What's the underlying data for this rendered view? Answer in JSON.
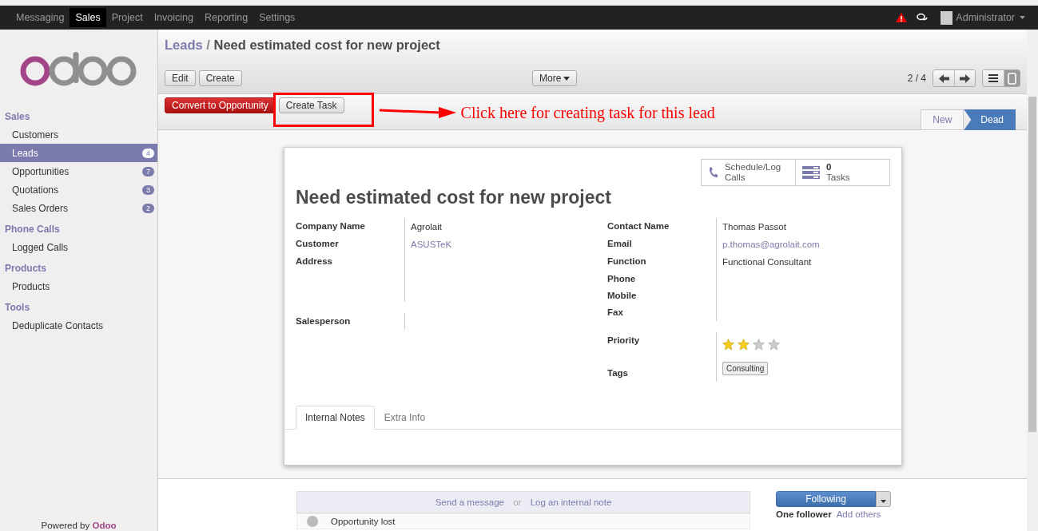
{
  "menu": [
    {
      "label": "Messaging",
      "selected": false
    },
    {
      "label": "Sales",
      "selected": true
    },
    {
      "label": "Project",
      "selected": false
    },
    {
      "label": "Invoicing",
      "selected": false
    },
    {
      "label": "Reporting",
      "selected": false
    },
    {
      "label": "Settings",
      "selected": false
    }
  ],
  "user": {
    "name": "Administrator"
  },
  "sidebar": {
    "sections": [
      {
        "title": "Sales",
        "items": [
          {
            "label": "Customers",
            "selected": false
          },
          {
            "label": "Leads",
            "count": "4",
            "selected": true
          },
          {
            "label": "Opportunities",
            "count": "7",
            "selected": false
          },
          {
            "label": "Quotations",
            "count": "3",
            "selected": false
          },
          {
            "label": "Sales Orders",
            "count": "2",
            "selected": false
          }
        ]
      },
      {
        "title": "Phone Calls",
        "items": [
          {
            "label": "Logged Calls",
            "selected": false
          }
        ]
      },
      {
        "title": "Products",
        "items": [
          {
            "label": "Products",
            "selected": false
          }
        ]
      },
      {
        "title": "Tools",
        "items": [
          {
            "label": "Deduplicate Contacts",
            "selected": false
          }
        ]
      }
    ],
    "footer": "Powered by **Odoo**"
  },
  "breadcrumb": {
    "parent": "Leads",
    "separator": "/",
    "current": "Need estimated cost for new project"
  },
  "toolbar": {
    "buttons": [
      "Edit",
      "Create"
    ],
    "more": "More",
    "pager": "2 / 4"
  },
  "actions": [
    {
      "label": "Convert to Opportunity",
      "kind": "primary"
    },
    {
      "label": "Create Task",
      "kind": "default"
    }
  ],
  "annotation": "Click here for creating task for this lead",
  "stages": [
    {
      "label": "New",
      "selected": false
    },
    {
      "label": "Dead",
      "selected": true
    }
  ],
  "form": {
    "smart_buttons": [
      {
        "kind": "phone",
        "label": "Schedule/Log Calls"
      },
      {
        "kind": "tasks",
        "count": "0",
        "label": "Tasks"
      }
    ],
    "title": "Need estimated cost for new project",
    "left_fields": [
      {
        "label": "Company Name",
        "value": "Agrolait",
        "link": false
      },
      {
        "label": "Customer",
        "value": "ASUSTeK",
        "link": true
      },
      {
        "label": "Address"
      }
    ],
    "right_fields": [
      {
        "label": "Contact Name",
        "value": "Thomas Passot",
        "link": false
      },
      {
        "label": "Email",
        "value": "p.thomas@agrolait.com",
        "link": true
      },
      {
        "label": "Function",
        "value": "Functional Consultant",
        "link": false
      },
      {
        "label": "Phone"
      },
      {
        "label": "Mobile"
      },
      {
        "label": "Fax"
      }
    ],
    "salesperson": {
      "label": "Salesperson"
    },
    "priority": {
      "label": "Priority",
      "stars": 2
    },
    "tags": {
      "label": "Tags",
      "values": [
        "Consulting"
      ]
    },
    "tabs": [
      {
        "label": "Internal Notes",
        "selected": true
      },
      {
        "label": "Extra Info",
        "selected": false
      }
    ]
  },
  "chatter": {
    "send": "Send a message",
    "or": "or",
    "log": "Log an internal note",
    "following": "Following",
    "message": "Opportunity lost",
    "followers": "One follower",
    "add": "Add others"
  }
}
